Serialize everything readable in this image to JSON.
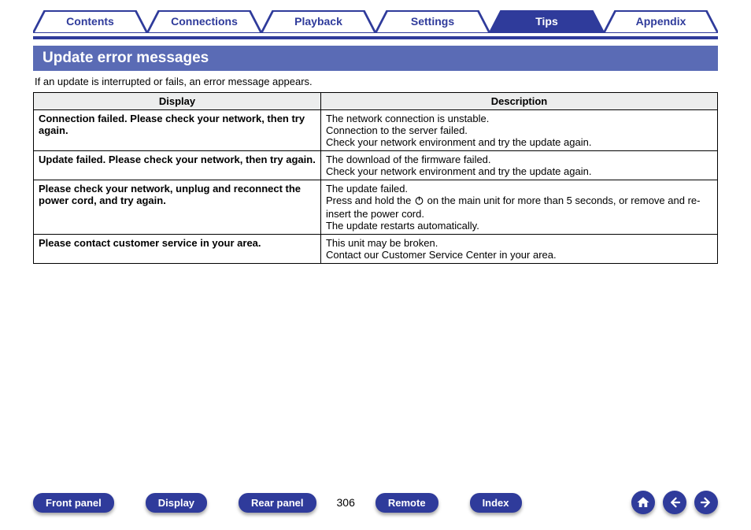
{
  "tabs": {
    "items": [
      {
        "label": "Contents"
      },
      {
        "label": "Connections"
      },
      {
        "label": "Playback"
      },
      {
        "label": "Settings"
      },
      {
        "label": "Tips"
      },
      {
        "label": "Appendix"
      }
    ],
    "active_index": 4
  },
  "section": {
    "title": "Update error messages",
    "intro": "If an update is interrupted or fails, an error message appears."
  },
  "table": {
    "headers": {
      "display": "Display",
      "description": "Description"
    },
    "rows": [
      {
        "display": "Connection failed. Please check your network, then try again.",
        "description_lines": [
          "The network connection is unstable.",
          "Connection to the server failed.",
          "Check your network environment and try the update again."
        ]
      },
      {
        "display": "Update failed. Please check your network, then try again.",
        "description_lines": [
          "The download of the firmware failed.",
          "Check your network environment and try the update again."
        ]
      },
      {
        "display": "Please check your network, unplug and reconnect the power cord, and try again.",
        "description_lines": [
          "The update failed.",
          {
            "pre": "Press and hold the ",
            "icon": "power",
            "post": " on the main unit for more than 5 seconds, or remove and re-insert the power cord."
          },
          "The update restarts automatically."
        ]
      },
      {
        "display": "Please contact customer service in your area.",
        "description_lines": [
          "This unit may be broken.",
          "Contact our Customer Service Center in your area."
        ]
      }
    ]
  },
  "footer": {
    "buttons": {
      "front_panel": "Front panel",
      "display": "Display",
      "rear_panel": "Rear panel",
      "remote": "Remote",
      "index": "Index"
    },
    "page_number": "306"
  }
}
